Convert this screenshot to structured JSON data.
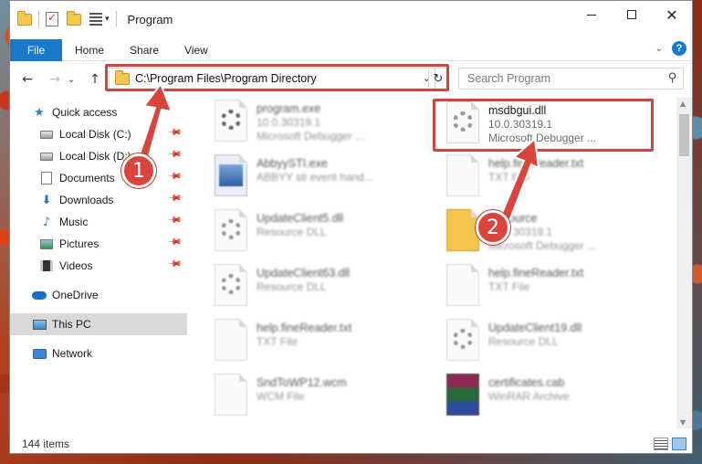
{
  "window": {
    "title": "Program",
    "tabs": [
      "Home",
      "Share",
      "View"
    ],
    "file_tab": "File",
    "minimize": "—",
    "maximize": "☐",
    "close": "✕"
  },
  "address": {
    "path": "C:\\Program Files\\Program Directory",
    "search_placeholder": "Search Program"
  },
  "sidebar": {
    "items": [
      {
        "label": "Quick access",
        "icon": "star-icon"
      },
      {
        "label": "Local Disk (C:)",
        "icon": "disk-icon",
        "pinned": true
      },
      {
        "label": "Local Disk (D:)",
        "icon": "disk-icon",
        "pinned": true
      },
      {
        "label": "Documents",
        "icon": "documents-icon",
        "pinned": true
      },
      {
        "label": "Downloads",
        "icon": "download-icon",
        "pinned": true
      },
      {
        "label": "Music",
        "icon": "music-icon",
        "pinned": true
      },
      {
        "label": "Pictures",
        "icon": "pictures-icon",
        "pinned": true
      },
      {
        "label": "Videos",
        "icon": "videos-icon",
        "pinned": true
      },
      {
        "label": "OneDrive",
        "icon": "onedrive-icon"
      },
      {
        "label": "This PC",
        "icon": "this-pc-icon",
        "selected": true
      },
      {
        "label": "Network",
        "icon": "network-icon"
      }
    ]
  },
  "files": [
    {
      "name": "program.exe",
      "line2": "10.0.30319.1",
      "line3": "Microsoft Debugger ...",
      "icon": "generic-file-icon"
    },
    {
      "name": "msdbgui.dll",
      "line2": "10.0.30319.1",
      "line3": "Microsoft Debugger ...",
      "icon": "dll-gear-icon"
    },
    {
      "name": "AbbyySTI.exe",
      "line2": "ABBYY sti event hand...",
      "line3": "",
      "icon": "exe-icon"
    },
    {
      "name": "help.fineReader.txt",
      "line2": "TXT File",
      "line3": "",
      "icon": "txt-file-icon"
    },
    {
      "name": "UpdateClient5.dll",
      "line2": "Resource DLL",
      "line3": "",
      "icon": "dll-gear-icon"
    },
    {
      "name": "Resource",
      "line2": "10.0.30319.1",
      "line3": "Microsoft Debugger ...",
      "icon": "folder-icon"
    },
    {
      "name": "UpdateClient63.dll",
      "line2": "Resource DLL",
      "line3": "",
      "icon": "dll-gear-icon"
    },
    {
      "name": "help.fineReader.txt",
      "line2": "TXT File",
      "line3": "",
      "icon": "txt-file-icon"
    },
    {
      "name": "help.fineReader.txt",
      "line2": "TXT File",
      "line3": "",
      "icon": "txt-file-icon"
    },
    {
      "name": "UpdateClient19.dll",
      "line2": "Resource DLL",
      "line3": "",
      "icon": "dll-gear-icon"
    },
    {
      "name": "SndToWP12.wcm",
      "line2": "WCM File",
      "line3": "",
      "icon": "generic-file-icon"
    },
    {
      "name": "certificates.cab",
      "line2": "WinRAR Archive",
      "line3": "",
      "icon": "winrar-icon"
    }
  ],
  "status": {
    "count": "144 items"
  },
  "annotations": {
    "step1": "1",
    "step2": "2"
  },
  "colors": {
    "accent": "#1979ca",
    "annotation_red": "#d2453e"
  }
}
